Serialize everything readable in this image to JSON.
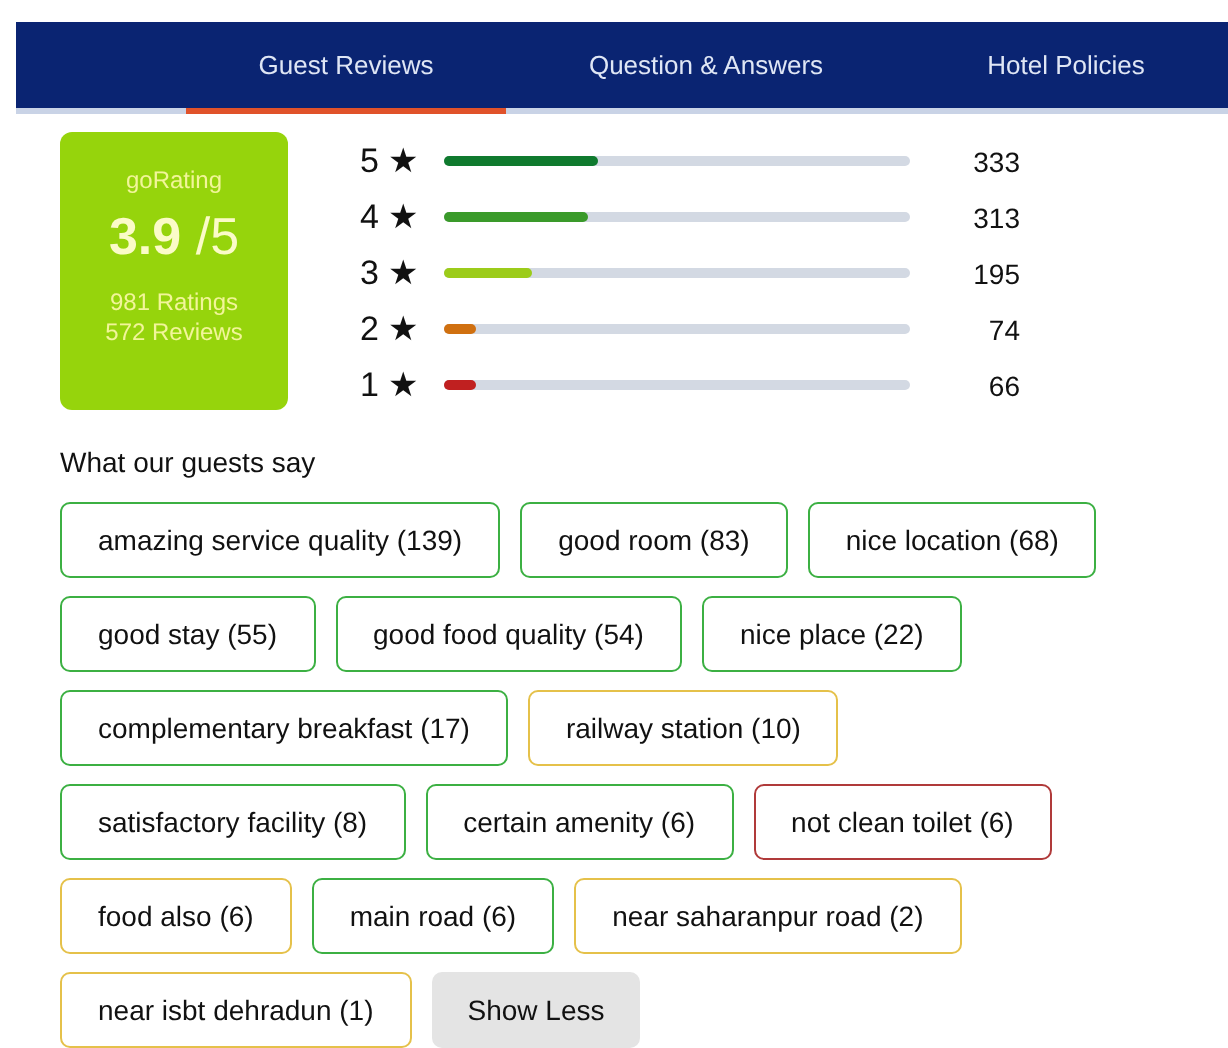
{
  "tabs": [
    {
      "label": "Guest Reviews",
      "selected": true
    },
    {
      "label": "Question & Answers",
      "selected": false
    },
    {
      "label": "Hotel Policies",
      "selected": false
    }
  ],
  "summary": {
    "title": "goRating",
    "score": "3.9",
    "scale": "/5",
    "ratings": "981 Ratings",
    "reviews": "572 Reviews"
  },
  "breakdown": [
    {
      "label": "5 ★",
      "level": 0.33,
      "count": "333",
      "color": "#0f7a2e"
    },
    {
      "label": "4 ★",
      "level": 0.31,
      "count": "313",
      "color": "#3a9a2a"
    },
    {
      "label": "3 ★",
      "level": 0.19,
      "count": "195",
      "color": "#9ccc1a"
    },
    {
      "label": "2 ★",
      "level": 0.07,
      "count": "74",
      "color": "#d07010"
    },
    {
      "label": "1 ★",
      "level": 0.07,
      "count": "66",
      "color": "#c02020"
    }
  ],
  "tags_heading": "What our guests say",
  "tags": [
    {
      "label": "amazing service quality (139)",
      "color": "#3cb043"
    },
    {
      "label": "good room (83)",
      "color": "#3cb043"
    },
    {
      "label": "nice location (68)",
      "color": "#3cb043"
    },
    {
      "label": "good stay (55)",
      "color": "#3cb043"
    },
    {
      "label": "good food quality (54)",
      "color": "#3cb043"
    },
    {
      "label": "nice place (22)",
      "color": "#3cb043"
    },
    {
      "label": "complementary breakfast (17)",
      "color": "#3cb043"
    },
    {
      "label": "railway station (10)",
      "color": "#e5c14a"
    },
    {
      "label": "satisfactory facility (8)",
      "color": "#3cb043"
    },
    {
      "label": "certain amenity (6)",
      "color": "#3cb043"
    },
    {
      "label": "not clean toilet (6)",
      "color": "#b03a3a"
    },
    {
      "label": "food also (6)",
      "color": "#e5c14a"
    },
    {
      "label": "main road (6)",
      "color": "#3cb043"
    },
    {
      "label": "near saharanpur road (2)",
      "color": "#e5c14a"
    },
    {
      "label": "near isbt dehradun (1)",
      "color": "#e5c14a"
    }
  ],
  "toggle_button": "Show Less"
}
